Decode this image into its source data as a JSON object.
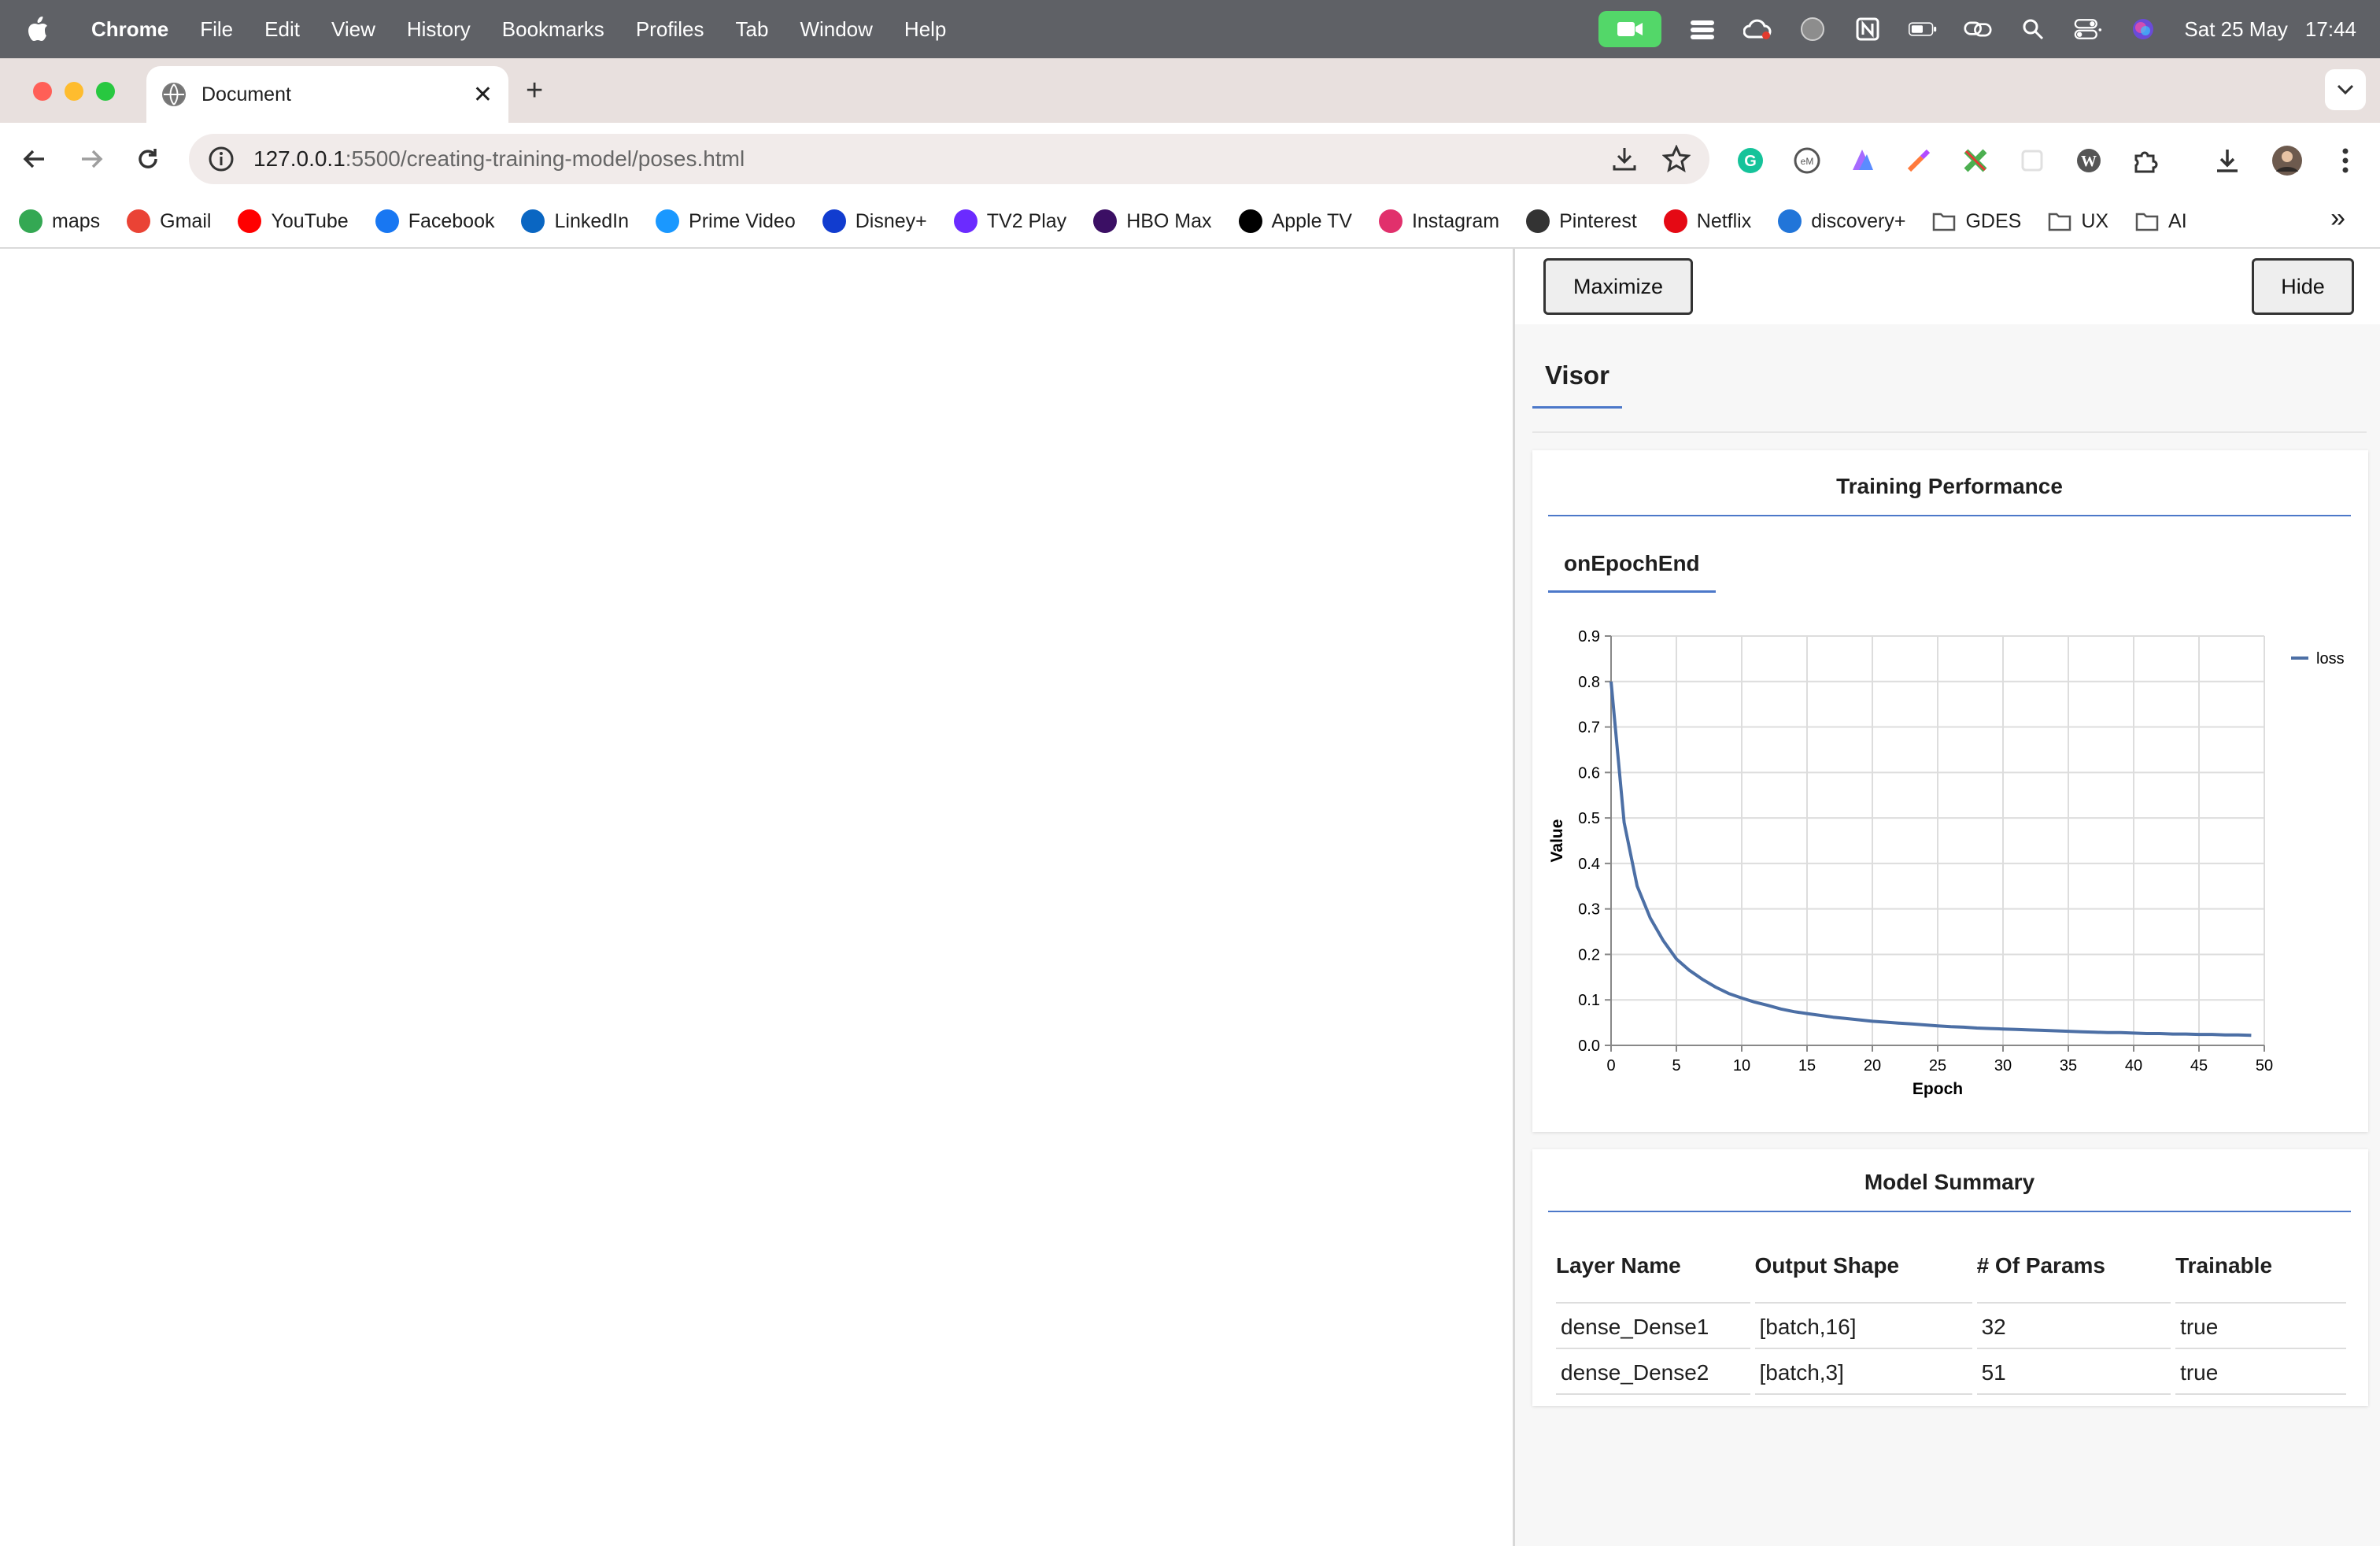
{
  "menubar": {
    "app": "Chrome",
    "items": [
      "File",
      "Edit",
      "View",
      "History",
      "Bookmarks",
      "Profiles",
      "Tab",
      "Window",
      "Help"
    ],
    "date": "Sat 25 May",
    "time": "17:44"
  },
  "browser": {
    "tab_title": "Document",
    "url_host": "127.0.0.1",
    "url_path": ":5500/creating-training-model/poses.html",
    "bookmarks": [
      {
        "label": "maps",
        "icon": "maps-icon",
        "color": "#34a853"
      },
      {
        "label": "Gmail",
        "icon": "gmail-icon",
        "color": "#ea4335"
      },
      {
        "label": "YouTube",
        "icon": "youtube-icon",
        "color": "#ff0000"
      },
      {
        "label": "Facebook",
        "icon": "facebook-icon",
        "color": "#1877f2"
      },
      {
        "label": "LinkedIn",
        "icon": "linkedin-icon",
        "color": "#0a66c2"
      },
      {
        "label": "Prime Video",
        "icon": "prime-video-icon",
        "color": "#1a98ff"
      },
      {
        "label": "Disney+",
        "icon": "disney-plus-icon",
        "color": "#113ccf"
      },
      {
        "label": "TV2 Play",
        "icon": "tv2-play-icon",
        "color": "#6b2bff"
      },
      {
        "label": "HBO Max",
        "icon": "hbo-max-icon",
        "color": "#3b0f64"
      },
      {
        "label": "Apple TV",
        "icon": "apple-tv-icon",
        "color": "#000000"
      },
      {
        "label": "Instagram",
        "icon": "instagram-icon",
        "color": "#e1306c"
      },
      {
        "label": "Pinterest",
        "icon": "pinterest-icon",
        "color": "#333333"
      },
      {
        "label": "Netflix",
        "icon": "netflix-icon",
        "color": "#e50914"
      },
      {
        "label": "discovery+",
        "icon": "discovery-plus-icon",
        "color": "#2175d9"
      },
      {
        "label": "GDES",
        "icon": "folder-icon",
        "color": "#555555"
      },
      {
        "label": "UX",
        "icon": "folder-icon",
        "color": "#555555"
      },
      {
        "label": "AI",
        "icon": "folder-icon",
        "color": "#555555"
      }
    ]
  },
  "visor": {
    "maximize_label": "Maximize",
    "hide_label": "Hide",
    "tab_label": "Visor",
    "performance": {
      "title": "Training Performance",
      "subtab": "onEpochEnd"
    },
    "summary": {
      "title": "Model Summary",
      "headers": [
        "Layer Name",
        "Output Shape",
        "# Of Params",
        "Trainable"
      ],
      "rows": [
        [
          "dense_Dense1",
          "[batch,16]",
          "32",
          "true"
        ],
        [
          "dense_Dense2",
          "[batch,3]",
          "51",
          "true"
        ]
      ]
    }
  },
  "chart_data": {
    "type": "line",
    "title": "",
    "xlabel": "Epoch",
    "ylabel": "Value",
    "xlim": [
      0,
      50
    ],
    "ylim": [
      0,
      0.9
    ],
    "x_ticks": [
      "0",
      "5",
      "10",
      "15",
      "20",
      "25",
      "30",
      "35",
      "40",
      "45",
      "50"
    ],
    "y_ticks": [
      "0.0",
      "0.1",
      "0.2",
      "0.3",
      "0.4",
      "0.5",
      "0.6",
      "0.7",
      "0.8",
      "0.9"
    ],
    "grid": true,
    "legend_position": "top-right",
    "series": [
      {
        "name": "loss",
        "color": "#4c6fa5",
        "x": [
          0,
          1,
          2,
          3,
          4,
          5,
          6,
          7,
          8,
          9,
          10,
          11,
          12,
          13,
          14,
          15,
          16,
          17,
          18,
          19,
          20,
          21,
          22,
          23,
          24,
          25,
          26,
          27,
          28,
          29,
          30,
          31,
          32,
          33,
          34,
          35,
          36,
          37,
          38,
          39,
          40,
          41,
          42,
          43,
          44,
          45,
          46,
          47,
          48,
          49
        ],
        "values": [
          0.8,
          0.49,
          0.35,
          0.28,
          0.23,
          0.19,
          0.165,
          0.145,
          0.128,
          0.114,
          0.104,
          0.095,
          0.088,
          0.08,
          0.074,
          0.07,
          0.066,
          0.062,
          0.059,
          0.056,
          0.053,
          0.051,
          0.049,
          0.047,
          0.045,
          0.043,
          0.041,
          0.04,
          0.038,
          0.037,
          0.036,
          0.035,
          0.034,
          0.033,
          0.032,
          0.031,
          0.03,
          0.029,
          0.028,
          0.028,
          0.027,
          0.026,
          0.026,
          0.025,
          0.025,
          0.024,
          0.024,
          0.023,
          0.023,
          0.022
        ]
      }
    ]
  }
}
